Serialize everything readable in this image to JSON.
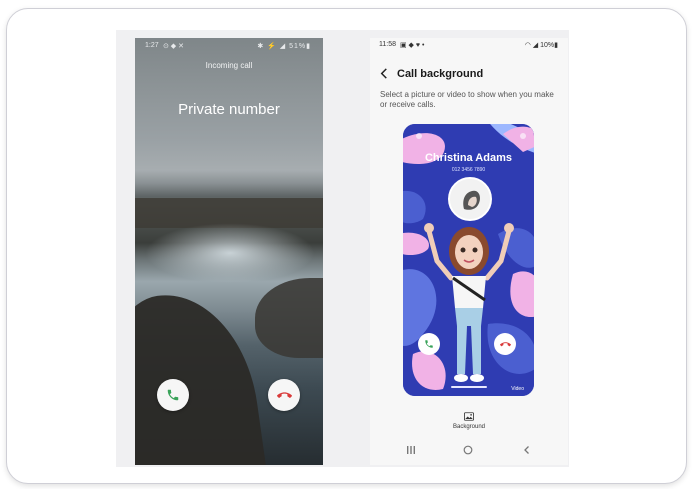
{
  "left_phone": {
    "status_time": "1:27",
    "status_icons_left": "⊙ ◆ ✕",
    "status_icons_right": "✱ ⚡ ◢ 51%▮",
    "incoming_label": "Incoming call",
    "caller_name": "Private number",
    "accept_icon": "phone-icon",
    "decline_icon": "phone-hangup-icon"
  },
  "right_phone": {
    "status_time": "11:58",
    "status_icons_left": "▣ ◆ ♥ •",
    "status_icons_right": "◠ ◢ 10%▮",
    "title": "Call background",
    "description": "Select a picture or video to show when you make or receive calls.",
    "preview": {
      "contact_name": "Christina Adams",
      "contact_number": "012 3456 7890",
      "video_label": "Video"
    },
    "background_button_label": "Background"
  },
  "colors": {
    "preview_bg": "#2f3cb2",
    "accept_green": "#3aa35a",
    "decline_red": "#d93a3a",
    "accent_pink": "#f1b2e6",
    "accent_light": "#9db8ff"
  }
}
